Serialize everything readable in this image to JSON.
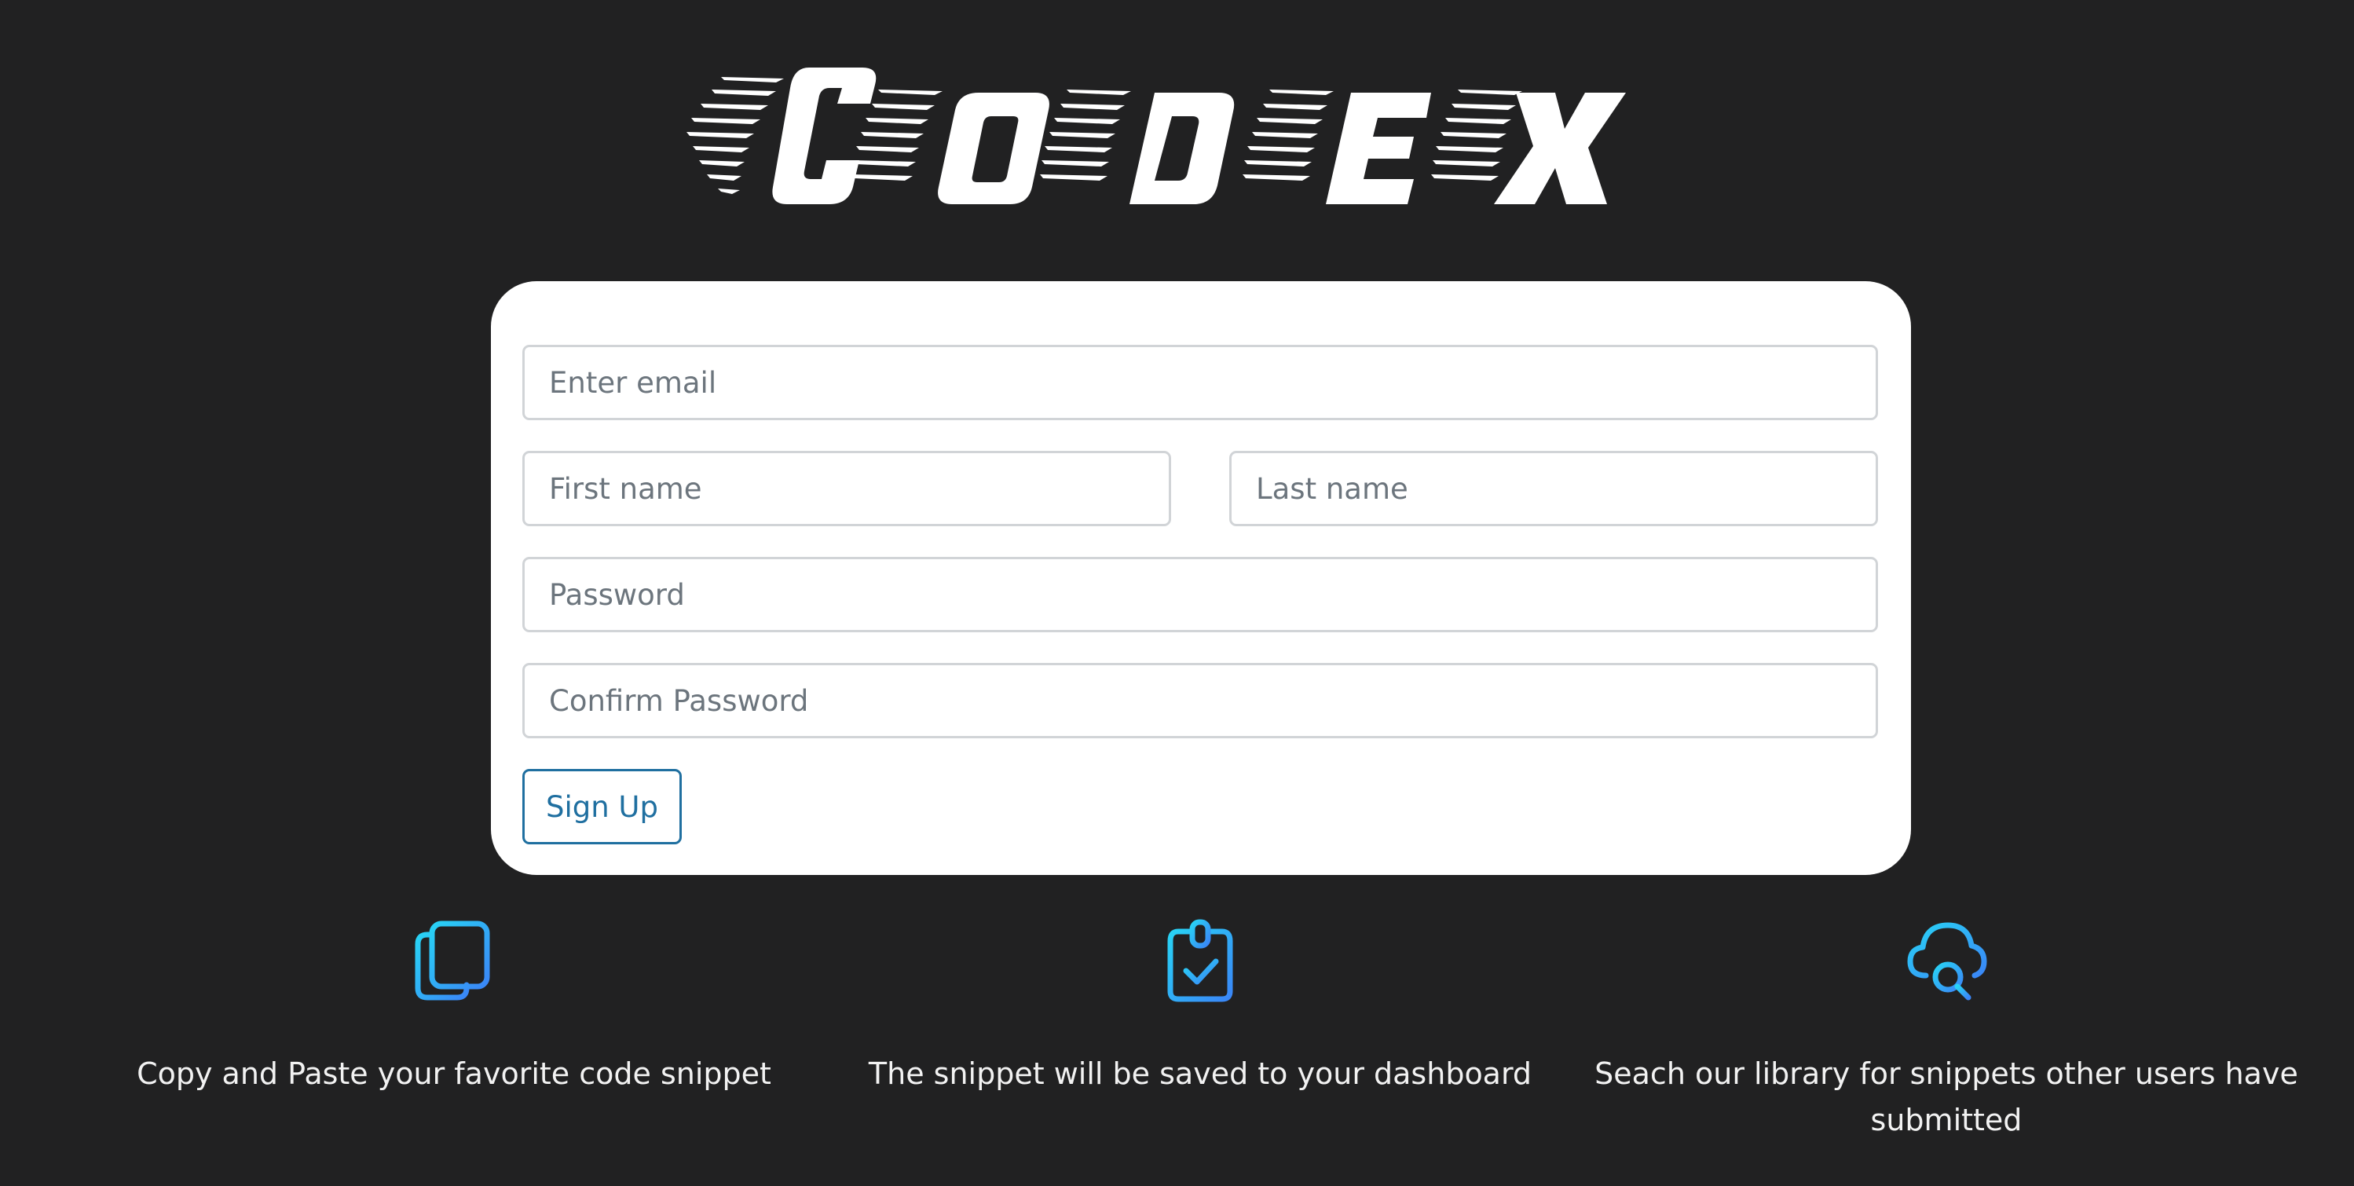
{
  "logo": {
    "text": "CODEX"
  },
  "form": {
    "email": {
      "placeholder": "Enter email",
      "value": ""
    },
    "first_name": {
      "placeholder": "First name",
      "value": ""
    },
    "last_name": {
      "placeholder": "Last name",
      "value": ""
    },
    "password": {
      "placeholder": "Password",
      "value": ""
    },
    "confirm_password": {
      "placeholder": "Confirm Password",
      "value": ""
    },
    "submit_label": "Sign Up"
  },
  "features": [
    {
      "icon": "copy-documents-icon",
      "text": "Copy and Paste your favorite code snippet"
    },
    {
      "icon": "clipboard-check-icon",
      "text": "The snippet will be saved to your dashboard"
    },
    {
      "icon": "cloud-search-icon",
      "text": "Seach our library for snippets other users have submitted"
    }
  ],
  "colors": {
    "background": "#212122",
    "card": "#ffffff",
    "accent_button": "#1f6fa0",
    "icon_gradient_start": "#28d3f5",
    "icon_gradient_end": "#3a86f7"
  }
}
